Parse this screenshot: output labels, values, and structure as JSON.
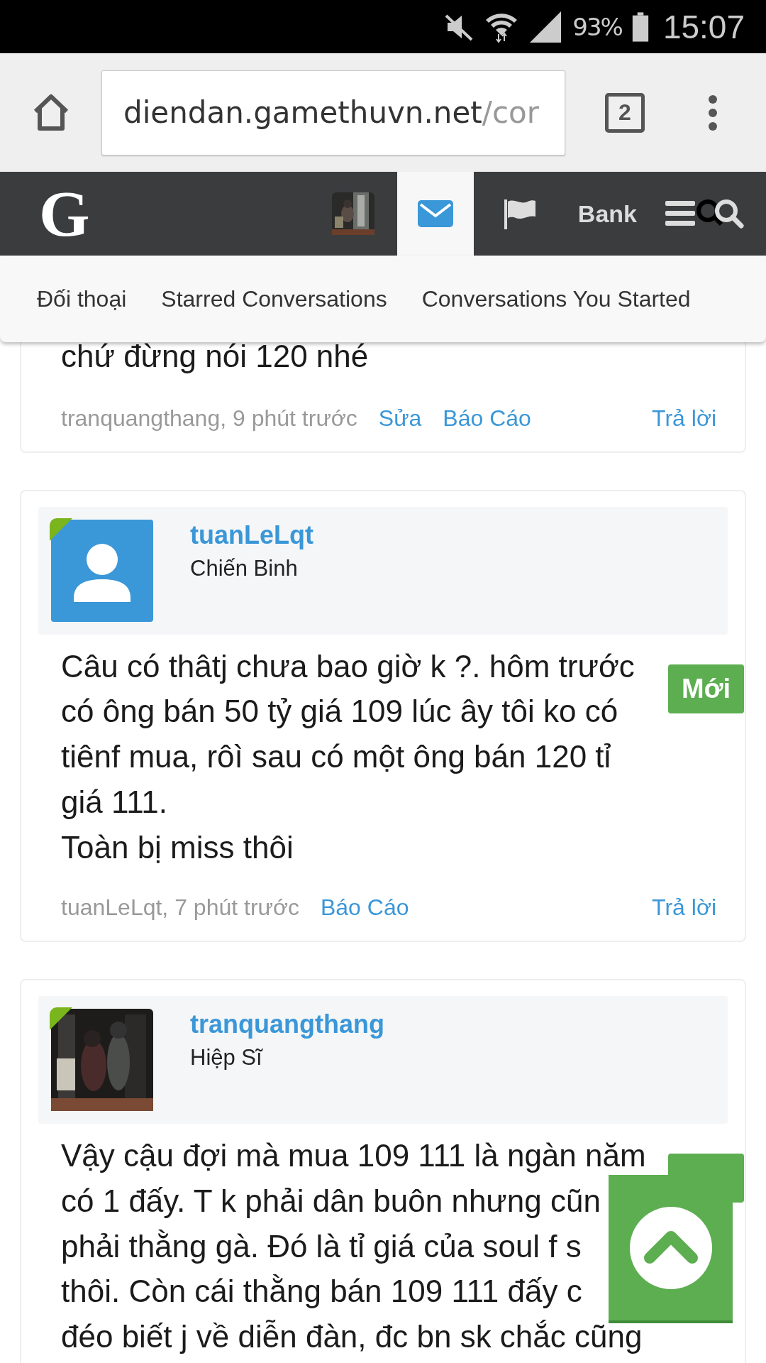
{
  "status_bar": {
    "battery": "93%",
    "time": "15:07"
  },
  "browser": {
    "url_host": "diendan.gamethuvn.net",
    "url_path": "/cor",
    "tab_count": "2"
  },
  "nav": {
    "logo": "G",
    "items": [
      {
        "kind": "avatar",
        "selected": false
      },
      {
        "kind": "mail",
        "selected": true
      },
      {
        "kind": "flag",
        "selected": false
      },
      {
        "kind": "text",
        "label": "Bank",
        "selected": false
      },
      {
        "kind": "menu",
        "selected": false
      },
      {
        "kind": "search",
        "selected": false
      }
    ]
  },
  "submenu": [
    "Đối thoại",
    "Starred Conversations",
    "Conversations You Started"
  ],
  "posts": [
    {
      "body": [
        [
          "chứ đừng nói 120 nhé"
        ]
      ],
      "meta": "tranquangthang, 9 phút trước",
      "actions": [
        "Sửa",
        "Báo Cáo"
      ],
      "reply": "Trả lời"
    },
    {
      "author": "tuanLeLqt",
      "rank": "Chiến Binh",
      "avatar": {
        "kind": "default"
      },
      "online": true,
      "new": true,
      "badge": "Mới",
      "body": [
        [
          "Câu có thâtj chưa bao giờ k ?. hôm trước",
          "có ông bán 50 tỷ giá 109 lúc ây tôi ko có",
          "tiênf mua, rôì sau có một ông bán 120 tỉ",
          "giá 111."
        ],
        [
          "Toàn bị miss thôi"
        ]
      ],
      "meta": "tuanLeLqt, 7 phút trước",
      "actions": [
        "Báo Cáo"
      ],
      "reply": "Trả lời"
    },
    {
      "author": "tranquangthang",
      "rank": "Hiệp Sĩ",
      "avatar": {
        "kind": "picture"
      },
      "online": true,
      "new": true,
      "body": [
        [
          "Vậy cậu đợi mà mua 109 111 là ngàn năm",
          "có 1 đấy. T k phải dân buôn nhưng cũn",
          "phải thằng gà. Đó là tỉ giá của soul f s",
          "thôi. Còn cái thằng bán 109 111 đấy c",
          "đéo biết j về diễn đàn, đc bn sk chắc cũng"
        ]
      ]
    }
  ]
}
